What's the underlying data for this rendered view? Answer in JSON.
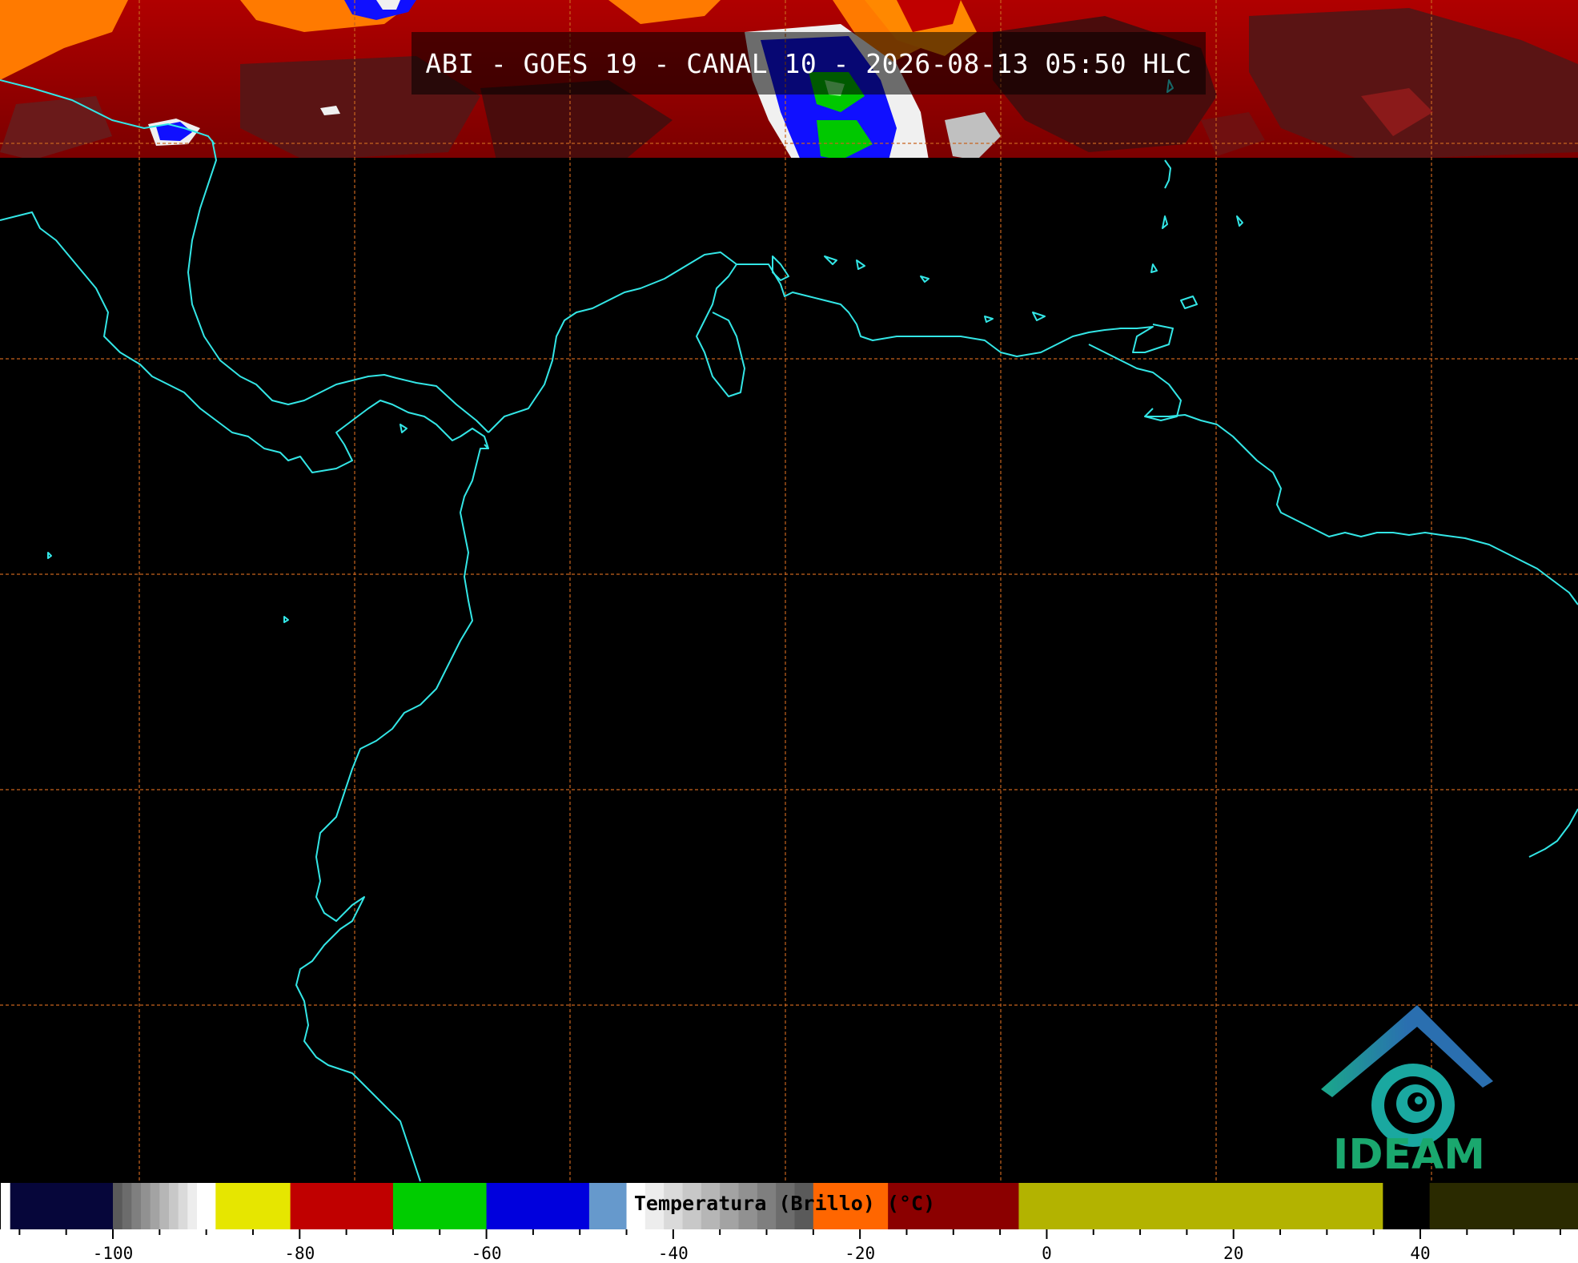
{
  "title": "ABI - GOES 19 - CANAL 10 - 2026-08-13 05:50 HLC",
  "logo": {
    "name": "IDEAM"
  },
  "colorbar": {
    "label": "Temperatura (Brillo) (°C)",
    "range": [
      -112,
      57
    ],
    "ticks": [
      -100,
      -80,
      -60,
      -40,
      -20,
      0,
      20,
      40
    ],
    "segments": [
      {
        "from": -112,
        "to": -111,
        "color": "#ffffff"
      },
      {
        "from": -111,
        "to": -100,
        "color": "#06063a"
      },
      {
        "from": -100,
        "to": -90,
        "color": "gray-ramp"
      },
      {
        "from": -90,
        "to": -89,
        "color": "#ffffff"
      },
      {
        "from": -89,
        "to": -81,
        "color": "#e6e600"
      },
      {
        "from": -81,
        "to": -70,
        "color": "#c00000"
      },
      {
        "from": -70,
        "to": -60,
        "color": "#00cc00"
      },
      {
        "from": -60,
        "to": -49,
        "color": "#0000dd"
      },
      {
        "from": -49,
        "to": -45,
        "color": "#6699cc"
      },
      {
        "from": -45,
        "to": -25,
        "color": "gray-ramp-down"
      },
      {
        "from": -25,
        "to": -17,
        "color": "#ff6600"
      },
      {
        "from": -17,
        "to": -3,
        "color": "#8b0000"
      },
      {
        "from": -3,
        "to": 36,
        "color": "#b3b300"
      },
      {
        "from": 36,
        "to": 41,
        "color": "#000000"
      },
      {
        "from": 41,
        "to": 57,
        "color": "#2a2a00"
      }
    ]
  },
  "map": {
    "coastline_color": "#33e6e6",
    "grid_color": "#c8641e",
    "background": "#000000",
    "cloud_colors": {
      "warm_high": "#cc0000",
      "orange": "#ff7a00",
      "dark_red": "#5a1010",
      "blue": "#1010ff",
      "green": "#00c800",
      "white": "#f0f0f0"
    }
  }
}
